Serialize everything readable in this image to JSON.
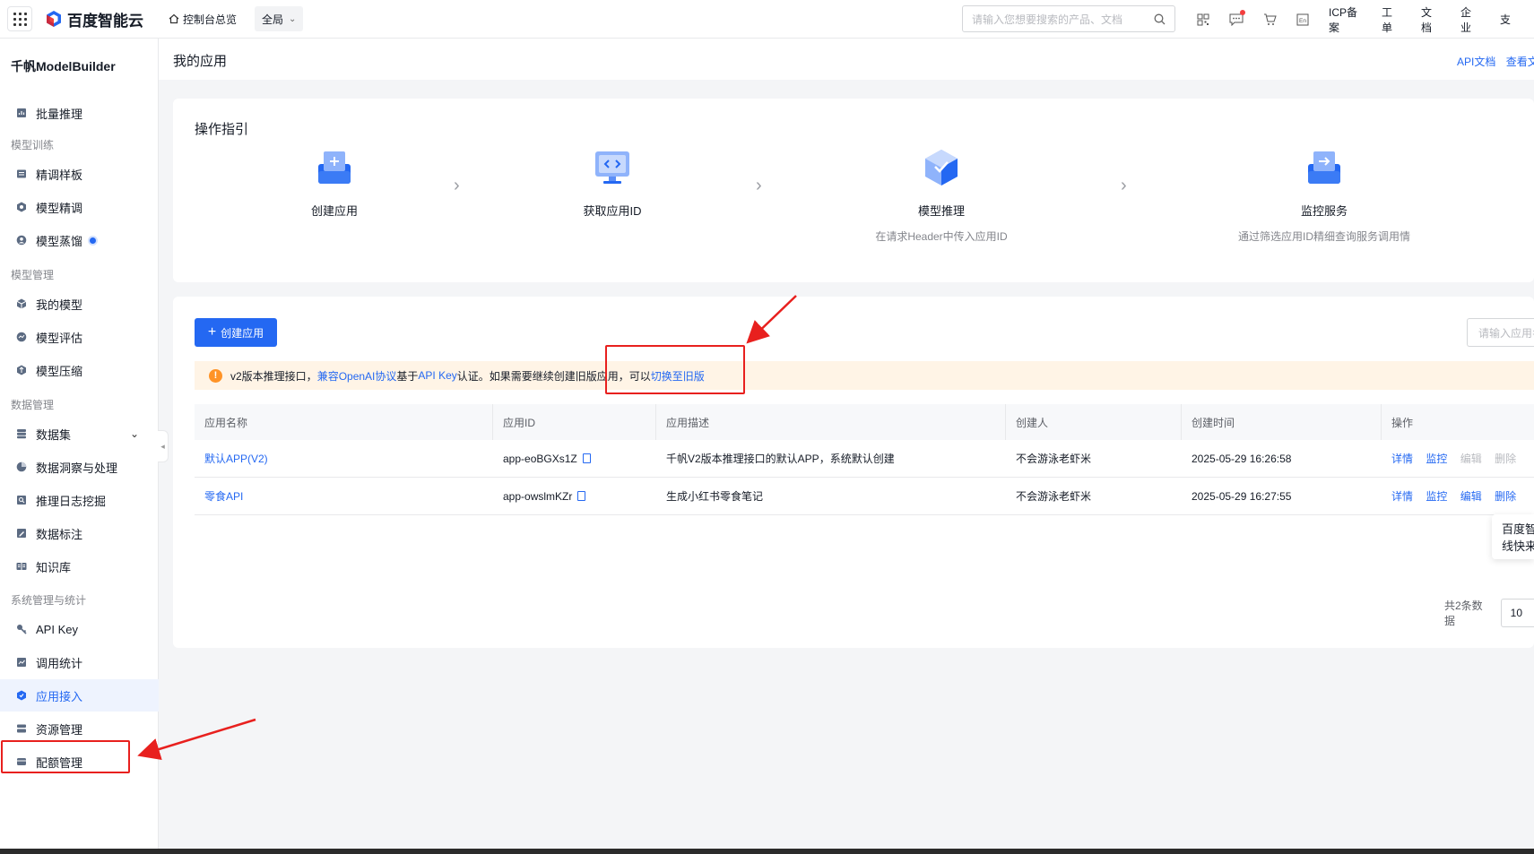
{
  "topbar": {
    "brand": "百度智能云",
    "console_home": "控制台总览",
    "region": "全局",
    "search_placeholder": "请输入您想要搜索的产品、文档",
    "links": [
      "ICP备案",
      "工单",
      "文档",
      "企业",
      "支"
    ],
    "icons": [
      "qr-icon",
      "message-icon",
      "cart-icon",
      "language-icon"
    ]
  },
  "sidebar": {
    "product": "千帆ModelBuilder",
    "items": [
      {
        "label": "批量推理",
        "icon": "batch-icon"
      },
      {
        "group": "模型训练"
      },
      {
        "label": "精调样板",
        "icon": "template-icon"
      },
      {
        "label": "模型精调",
        "icon": "tune-icon"
      },
      {
        "label": "模型蒸馏",
        "icon": "distill-icon",
        "badge": true
      },
      {
        "group": "模型管理"
      },
      {
        "label": "我的模型",
        "icon": "cube-icon"
      },
      {
        "label": "模型评估",
        "icon": "evaluate-icon"
      },
      {
        "label": "模型压缩",
        "icon": "compress-icon"
      },
      {
        "group": "数据管理"
      },
      {
        "label": "数据集",
        "icon": "database-icon",
        "expandable": true
      },
      {
        "label": "数据洞察与处理",
        "icon": "pie-icon"
      },
      {
        "label": "推理日志挖掘",
        "icon": "log-icon"
      },
      {
        "label": "数据标注",
        "icon": "annotate-icon"
      },
      {
        "label": "知识库",
        "icon": "book-icon"
      },
      {
        "group": "系统管理与统计"
      },
      {
        "label": "API Key",
        "icon": "key-icon"
      },
      {
        "label": "调用统计",
        "icon": "chart-icon"
      },
      {
        "label": "应用接入",
        "icon": "app-icon",
        "active": true
      },
      {
        "label": "资源管理",
        "icon": "resource-icon"
      },
      {
        "label": "配额管理",
        "icon": "quota-icon"
      }
    ]
  },
  "page": {
    "title": "我的应用",
    "links": [
      "API文档",
      "查看文"
    ]
  },
  "guide": {
    "title": "操作指引",
    "steps": [
      {
        "name": "创建应用",
        "desc": ""
      },
      {
        "name": "获取应用ID",
        "desc": ""
      },
      {
        "name": "模型推理",
        "desc": "在请求Header中传入应用ID"
      },
      {
        "name": "监控服务",
        "desc": "通过筛选应用ID精细查询服务调用情"
      }
    ]
  },
  "apps": {
    "create_label": "创建应用",
    "filter_placeholder": "请输入应用名称",
    "notice": {
      "part1": "v2版本推理接口，",
      "link1": "兼容OpenAI协议",
      "part2": "基于",
      "link2": "API Key",
      "part3": "认证。如果需要继续创建旧版应用，可以",
      "link3": "切换至旧版"
    },
    "columns": [
      "应用名称",
      "应用ID",
      "应用描述",
      "创建人",
      "创建时间",
      "操作"
    ],
    "rows": [
      {
        "name": "默认APP(V2)",
        "id": "app-eoBGXs1Z",
        "desc": "千帆V2版本推理接口的默认APP，系统默认创建",
        "creator": "不会游泳老虾米",
        "time": "2025-05-29 16:26:58",
        "ops": [
          "详情",
          "监控",
          "编辑",
          "删除"
        ],
        "ops_disabled": [
          false,
          false,
          true,
          true
        ]
      },
      {
        "name": "零食API",
        "id": "app-owslmKZr",
        "desc": "生成小红书零食笔记",
        "creator": "不会游泳老虾米",
        "time": "2025-05-29 16:27:55",
        "ops": [
          "详情",
          "监控",
          "编辑",
          "删除"
        ],
        "ops_disabled": [
          false,
          false,
          false,
          false
        ]
      }
    ],
    "total": "共2条数据",
    "page_size": "10"
  },
  "float_tip": [
    "百度智",
    "线快来"
  ],
  "colors": {
    "primary": "#2468f2",
    "annotation": "#e8201e",
    "warning": "#ff9326"
  }
}
